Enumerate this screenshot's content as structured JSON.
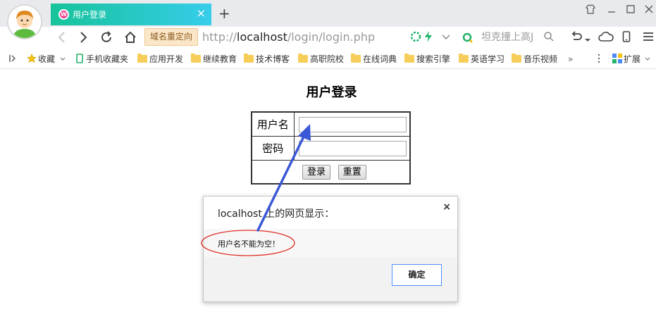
{
  "browser": {
    "tab": {
      "title": "用户登录",
      "favicon_letter": "W"
    },
    "address": {
      "redirect_badge": "域名重定向",
      "url_prefix": "http://",
      "url_host": "localhost",
      "url_path": "/login/login.php",
      "search_placeholder": "坦克撞上高J"
    },
    "bookmarks": [
      {
        "label": "收藏",
        "icon": "star-icon"
      },
      {
        "label": "手机收藏夹",
        "icon": "phone-icon"
      },
      {
        "label": "应用开发",
        "icon": "folder-icon"
      },
      {
        "label": "继续教育",
        "icon": "folder-icon"
      },
      {
        "label": "技术博客",
        "icon": "folder-icon"
      },
      {
        "label": "高职院校",
        "icon": "folder-icon"
      },
      {
        "label": "在线词典",
        "icon": "folder-icon"
      },
      {
        "label": "搜索引擎",
        "icon": "folder-icon"
      },
      {
        "label": "英语学习",
        "icon": "folder-icon"
      },
      {
        "label": "音乐视频",
        "icon": "folder-icon"
      }
    ],
    "extensions_label": "扩展"
  },
  "page": {
    "heading": "用户登录",
    "form": {
      "username_label": "用户名",
      "username_value": "",
      "password_label": "密码",
      "password_value": "",
      "login_button": "登录",
      "reset_button": "重置"
    }
  },
  "dialog": {
    "title": "localhost 上的网页显示：",
    "message": "用户名不能为空！",
    "ok_button": "确定"
  },
  "annotations": {
    "arrow_color": "#3a57d6",
    "ellipse_color": "#e0302a"
  },
  "colors": {
    "tab_gradient_start": "#17c39a",
    "tab_gradient_end": "#36cdea",
    "dialog_button_border": "#4d90fe"
  }
}
